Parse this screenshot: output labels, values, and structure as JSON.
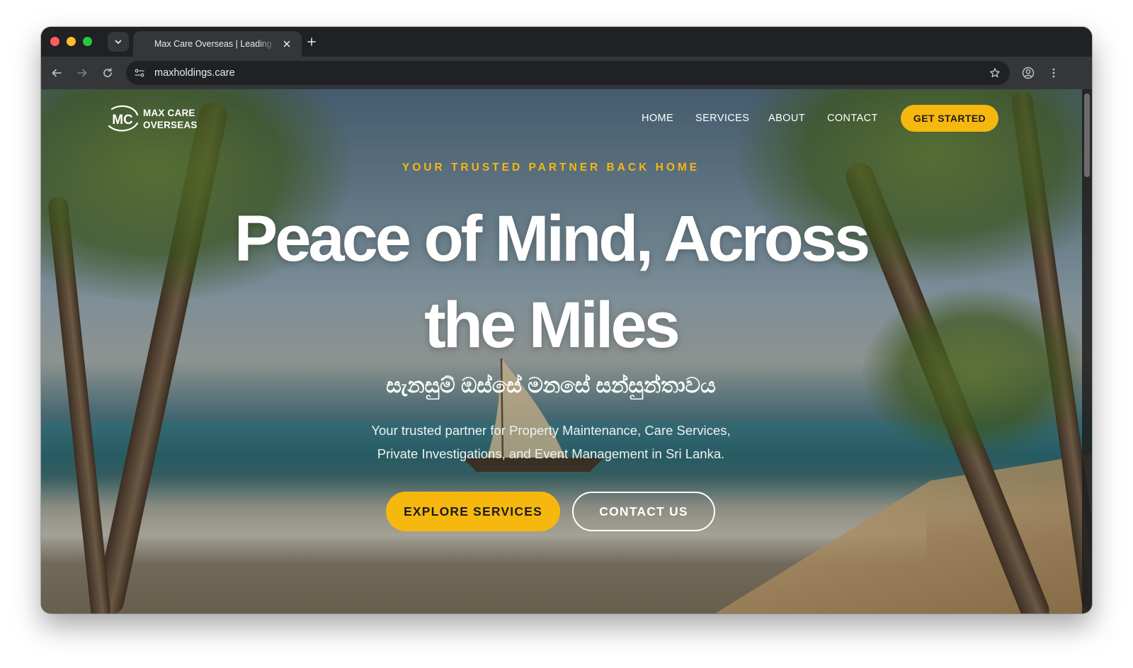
{
  "browser": {
    "tab_title": "Max Care Overseas | Leading",
    "url": "maxholdings.care",
    "icons": [
      "tab-search-icon",
      "close-icon",
      "plus-icon",
      "back-icon",
      "forward-icon",
      "reload-icon",
      "site-info-icon",
      "star-icon",
      "profile-icon",
      "menu-icon"
    ]
  },
  "site": {
    "logo": {
      "monogram": "MC",
      "line1": "MAX CARE",
      "line2": "OVERSEAS"
    },
    "nav": [
      {
        "label": "HOME"
      },
      {
        "label": "SERVICES"
      },
      {
        "label": "ABOUT"
      },
      {
        "label": "CONTACT"
      }
    ],
    "cta_label": "GET STARTED"
  },
  "hero": {
    "eyebrow": "YOUR TRUSTED PARTNER BACK HOME",
    "headline_line1": "Peace of Mind, Across",
    "headline_line2": "the Miles",
    "sinhala": "සැනසුම් ඔස්සේ මනසේ සන්සුන්තාවය",
    "subtitle_line1": "Your trusted partner for Property Maintenance, Care Services,",
    "subtitle_line2": "Private Investigations, and Event Management in Sri Lanka.",
    "primary_button": "EXPLORE SERVICES",
    "secondary_button": "CONTACT US"
  },
  "colors": {
    "accent": "#f6b70f",
    "browser_chrome": "#35363a",
    "tab_strip": "#1f2124",
    "text_on_hero": "#ffffff"
  }
}
